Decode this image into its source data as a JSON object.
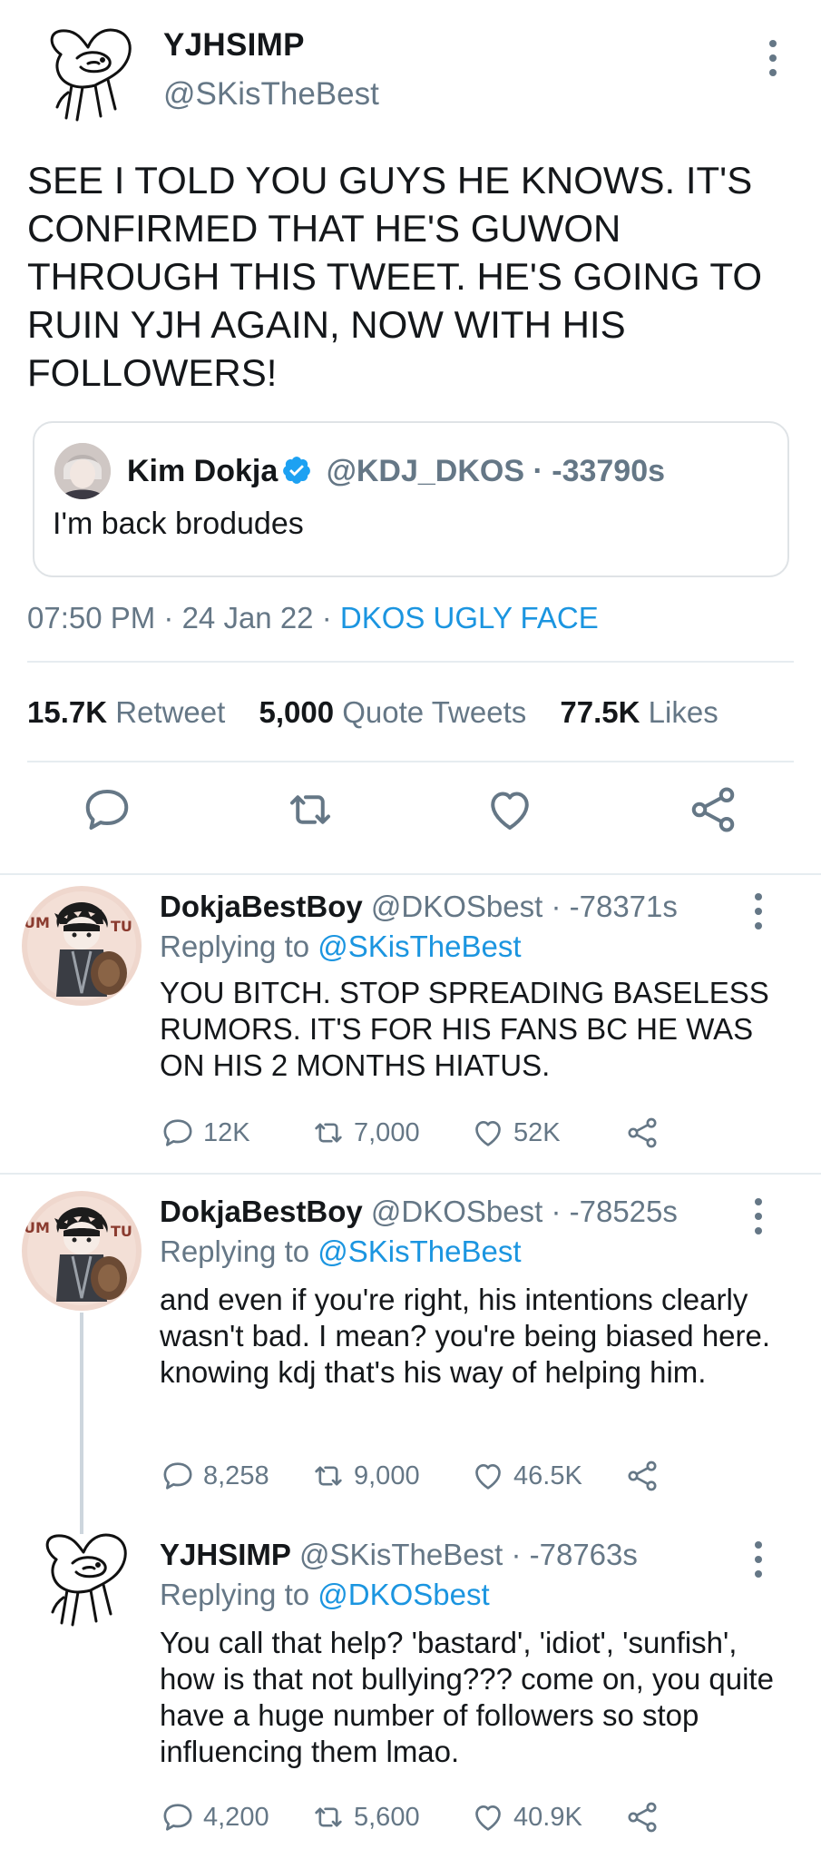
{
  "main_tweet": {
    "display_name": "YJHSIMP",
    "handle": "@SKisTheBest",
    "text": "SEE I TOLD YOU GUYS HE KNOWS. IT'S CONFIRMED THAT HE'S GUWON THROUGH THIS TWEET. HE'S GOING TO RUIN YJH AGAIN, NOW WITH HIS FOLLOWERS!",
    "quote": {
      "display_name": "Kim Dokja",
      "handle_time": "@KDJ_DKOS · -33790s",
      "text": "I'm back brodudes"
    },
    "timestamp": "07:50 PM · 24 Jan 22 · ",
    "source": "DKOS UGLY FACE",
    "stats": {
      "retweets_count": "15.7K",
      "retweets_label": "Retweet",
      "quotes_count": "5,000",
      "quotes_label": "Quote Tweets",
      "likes_count": "77.5K",
      "likes_label": "Likes"
    }
  },
  "replies": [
    {
      "display_name": "DokjaBestBoy",
      "handle_time": "@DKOSbest · -78371s",
      "replying_prefix": "Replying to ",
      "replying_to": "@SKisTheBest",
      "text": "YOU BITCH. STOP SPREADING BASELESS RUMORS. IT'S FOR HIS FANS BC HE WAS ON HIS 2 MONTHS HIATUS.",
      "replies": "12K",
      "retweets": "7,000",
      "likes": "52K"
    },
    {
      "display_name": "DokjaBestBoy",
      "handle_time": "@DKOSbest · -78525s",
      "replying_prefix": "Replying to ",
      "replying_to": "@SKisTheBest",
      "text": "and even if you're right, his intentions clearly wasn't bad. I mean? you're being biased here. knowing kdj that's his way of helping him.",
      "replies": "8,258",
      "retweets": "9,000",
      "likes": "46.5K"
    },
    {
      "display_name": "YJHSIMP",
      "handle_time": "@SKisTheBest · -78763s",
      "replying_prefix": "Replying to ",
      "replying_to": "@DKOSbest",
      "text": "You call that help? 'bastard', 'idiot', 'sunfish', how is that not bullying??? come on, you quite have a huge number of followers so stop influencing them lmao.",
      "replies": "4,200",
      "retweets": "5,600",
      "likes": "40.9K"
    }
  ],
  "colors": {
    "link": "#1b95e0",
    "secondary_text": "#657786",
    "divider": "#e6ecf0",
    "verified": "#1da1f2"
  }
}
